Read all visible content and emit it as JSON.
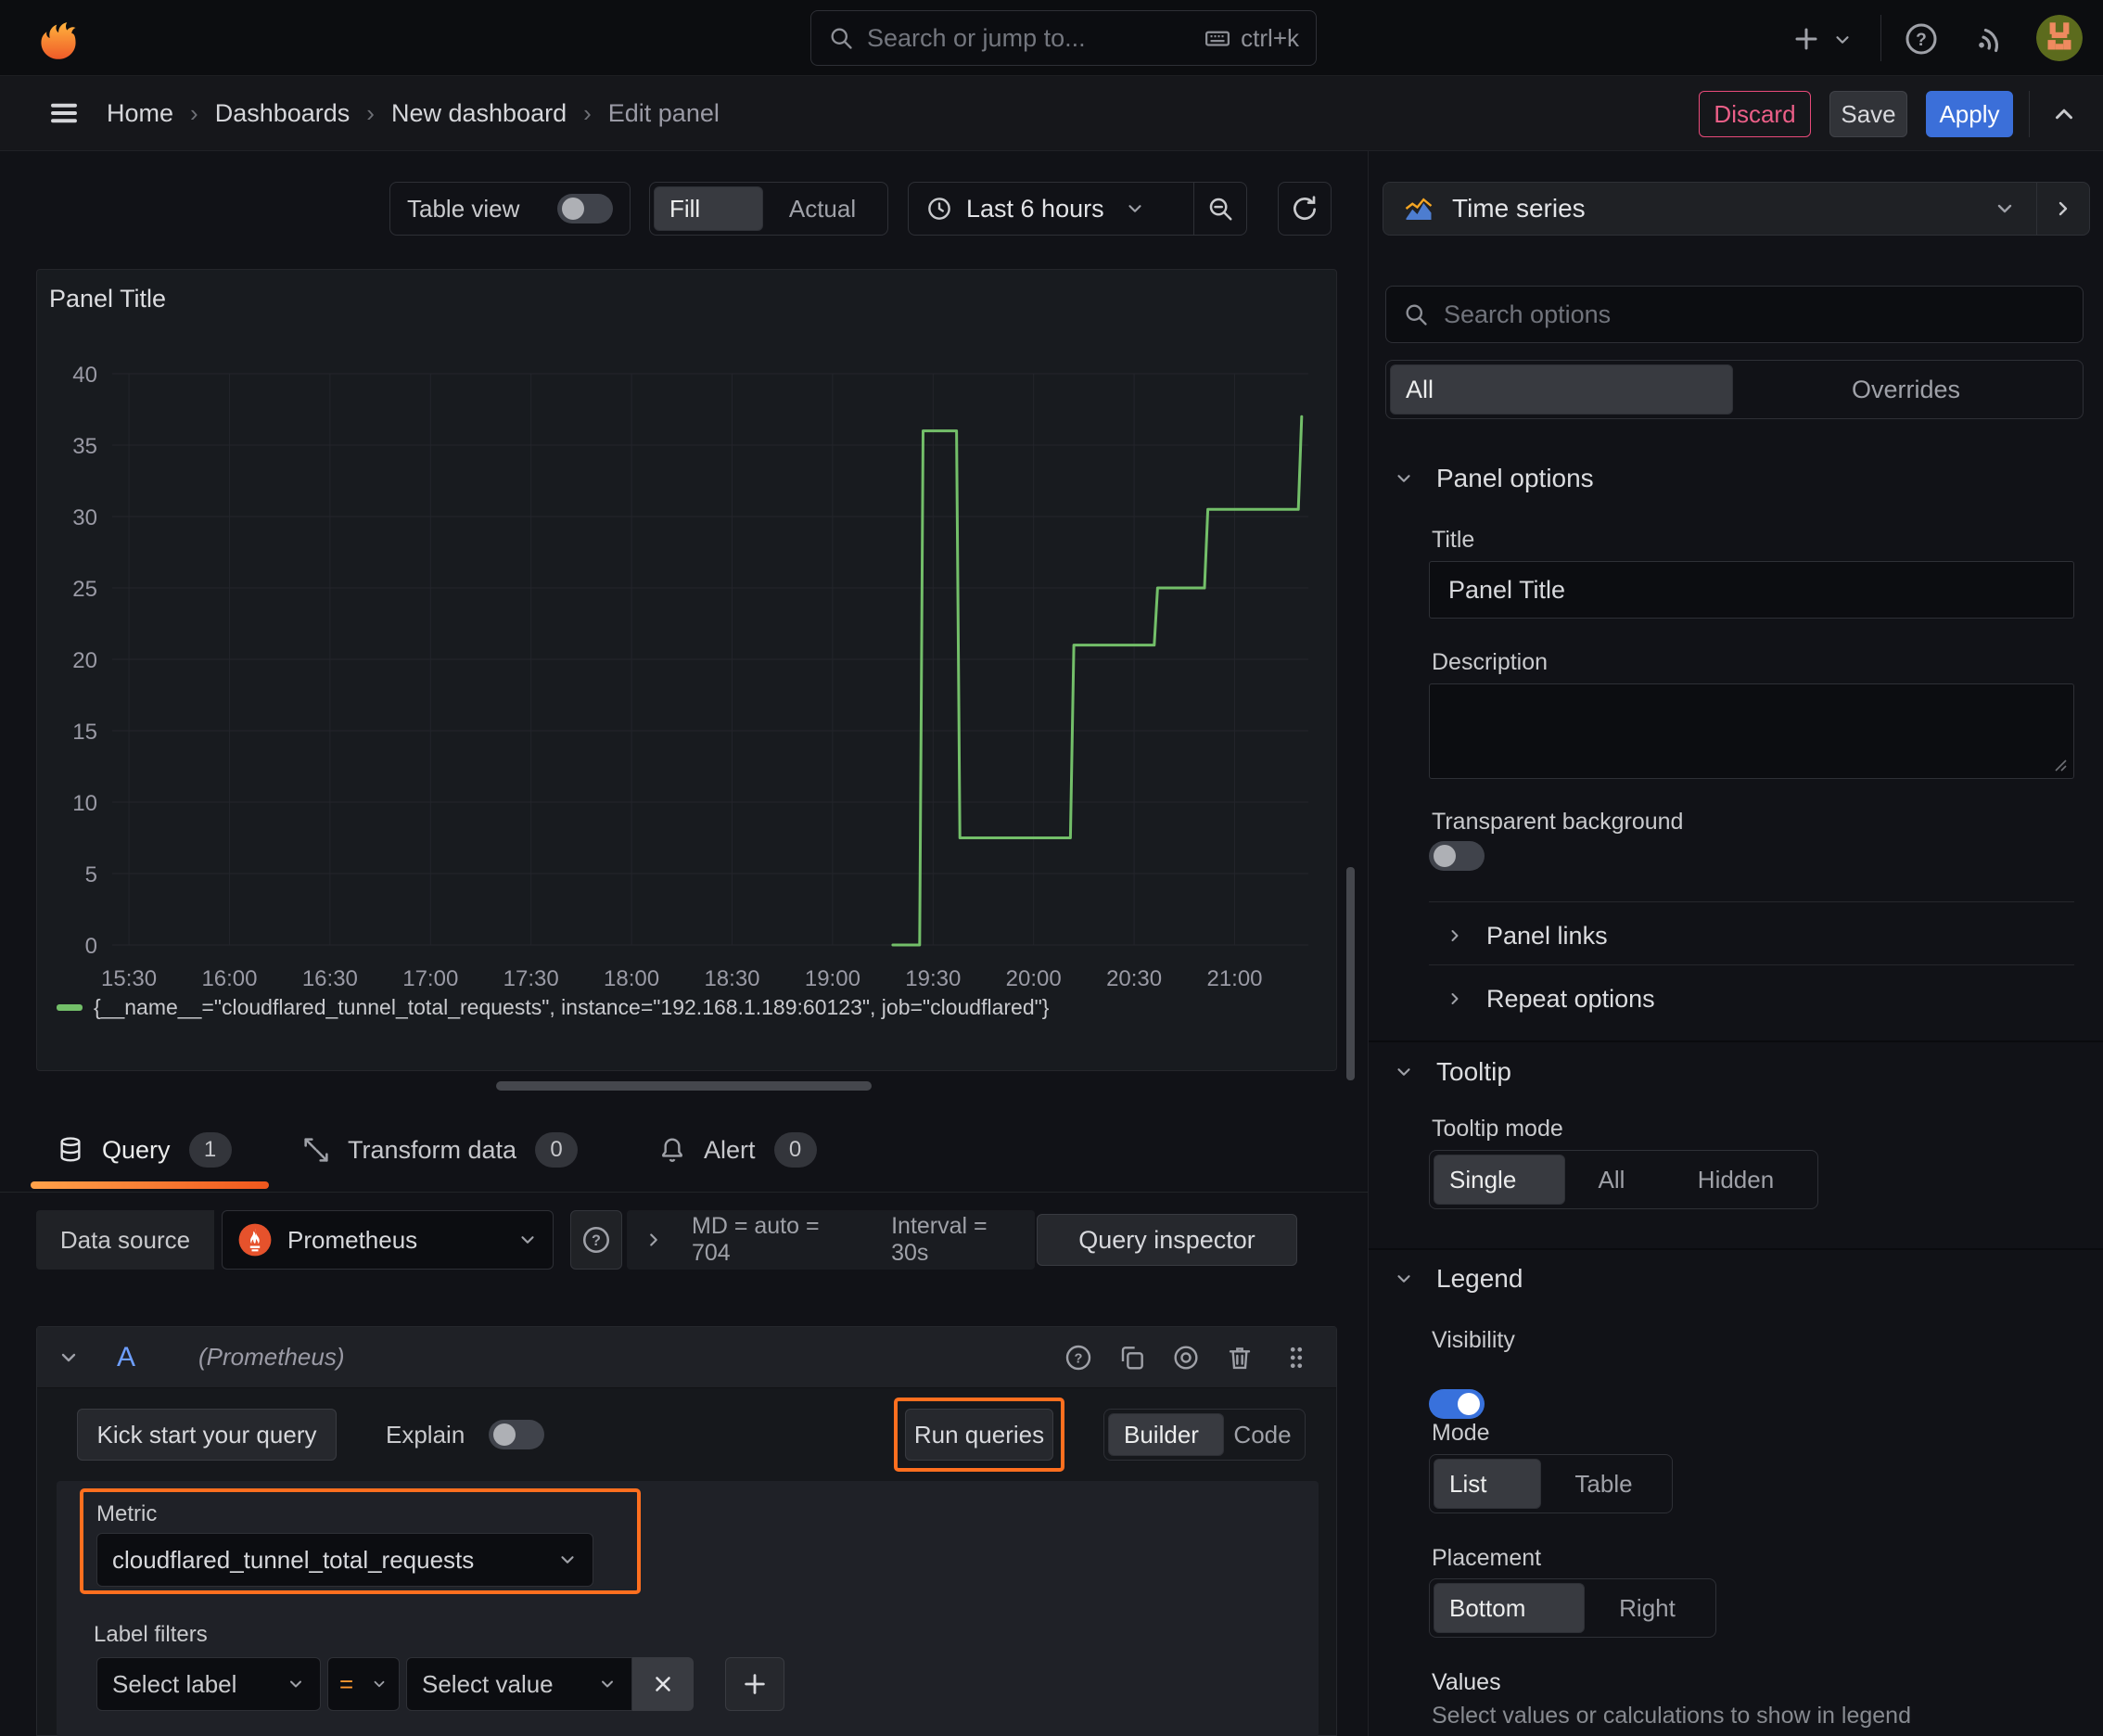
{
  "topbar": {
    "search_placeholder": "Search or jump to...",
    "shortcut": "ctrl+k"
  },
  "breadcrumb": {
    "separator": "›",
    "items": [
      "Home",
      "Dashboards",
      "New dashboard",
      "Edit panel"
    ]
  },
  "actions": {
    "discard": "Discard",
    "save": "Save",
    "apply": "Apply"
  },
  "toolbar": {
    "table_view": "Table view",
    "fill": "Fill",
    "actual": "Actual",
    "time_range": "Last 6 hours"
  },
  "viz_picker": {
    "label": "Time series"
  },
  "panel": {
    "title": "Panel Title"
  },
  "chart_data": {
    "type": "line",
    "title": "Panel Title",
    "line_interpolation": "step",
    "x_axis": "time",
    "x_domain_minutes": [
      925,
      1282
    ],
    "y_domain": [
      0,
      40
    ],
    "ylim": [
      0,
      40
    ],
    "grid": true,
    "legend_position": "bottom",
    "y_ticks": [
      0,
      5,
      10,
      15,
      20,
      25,
      30,
      35,
      40
    ],
    "x_ticks": [
      {
        "minute": 930,
        "label": "15:30"
      },
      {
        "minute": 960,
        "label": "16:00"
      },
      {
        "minute": 990,
        "label": "16:30"
      },
      {
        "minute": 1020,
        "label": "17:00"
      },
      {
        "minute": 1050,
        "label": "17:30"
      },
      {
        "minute": 1080,
        "label": "18:00"
      },
      {
        "minute": 1110,
        "label": "18:30"
      },
      {
        "minute": 1140,
        "label": "19:00"
      },
      {
        "minute": 1170,
        "label": "19:30"
      },
      {
        "minute": 1200,
        "label": "20:00"
      },
      {
        "minute": 1230,
        "label": "20:30"
      },
      {
        "minute": 1260,
        "label": "21:00"
      }
    ],
    "series": [
      {
        "name": "{__name__=\"cloudflared_tunnel_total_requests\", instance=\"192.168.1.189:60123\", job=\"cloudflared\"}",
        "color": "#73bf69",
        "points": [
          [
            1158,
            0
          ],
          [
            1166,
            0
          ],
          [
            1167,
            36
          ],
          [
            1177,
            36
          ],
          [
            1178,
            7.5
          ],
          [
            1211,
            7.5
          ],
          [
            1212,
            21
          ],
          [
            1236,
            21
          ],
          [
            1237,
            25
          ],
          [
            1251,
            25
          ],
          [
            1252,
            30.5
          ],
          [
            1279,
            30.5
          ],
          [
            1280,
            37
          ]
        ]
      }
    ]
  },
  "tabs": {
    "query": {
      "label": "Query",
      "count": "1"
    },
    "transform": {
      "label": "Transform data",
      "count": "0"
    },
    "alert": {
      "label": "Alert",
      "count": "0"
    }
  },
  "datasource": {
    "label": "Data source",
    "name": "Prometheus",
    "stats_md": "MD = auto = 704",
    "stats_interval": "Interval = 30s",
    "query_inspector": "Query inspector"
  },
  "query_editor": {
    "ref_id": "A",
    "ds_hint": "(Prometheus)",
    "kick_start": "Kick start your query",
    "explain": "Explain",
    "run_queries": "Run queries",
    "builder": "Builder",
    "code": "Code",
    "metric_label": "Metric",
    "metric_value": "cloudflared_tunnel_total_requests",
    "label_filters": "Label filters",
    "select_label": "Select label",
    "operator": "=",
    "select_value": "Select value"
  },
  "options": {
    "search_placeholder": "Search options",
    "tab_all": "All",
    "tab_overrides": "Overrides",
    "panel_options": {
      "title": "Panel options",
      "title_label": "Title",
      "title_value": "Panel Title",
      "description_label": "Description",
      "transparent": "Transparent background"
    },
    "collapsed": {
      "panel_links": "Panel links",
      "repeat_options": "Repeat options"
    },
    "tooltip": {
      "title": "Tooltip",
      "mode_label": "Tooltip mode",
      "modes": [
        "Single",
        "All",
        "Hidden"
      ]
    },
    "legend": {
      "title": "Legend",
      "visibility": "Visibility",
      "mode_label": "Mode",
      "modes": [
        "List",
        "Table"
      ],
      "placement_label": "Placement",
      "placements": [
        "Bottom",
        "Right"
      ],
      "values_label": "Values",
      "values_desc": "Select values or calculations to show in legend"
    }
  },
  "colors": {
    "series_green": "#73bf69",
    "accent_orange": "#ff780a",
    "annotation_orange": "#ff6f1f",
    "primary_blue": "#3b6fd9",
    "danger_pink": "#e84a7a"
  }
}
